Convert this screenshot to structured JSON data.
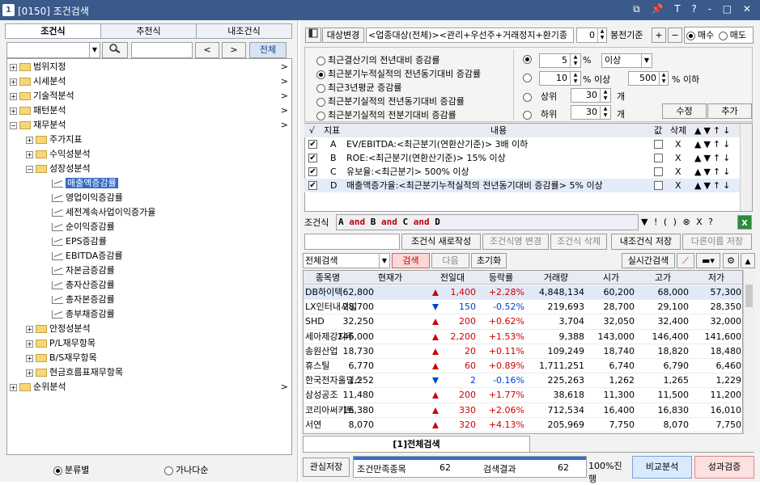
{
  "window": {
    "num": "1",
    "title": "[0150] 조건검색",
    "controls": "⧉ 📌 T ? ‑ □ ✕"
  },
  "left": {
    "tabs": [
      "조건식",
      "추천식",
      "내조건식"
    ],
    "search": {
      "prev": "<",
      "next": ">",
      "all": "전체"
    },
    "tree": [
      {
        "label": "범위지정",
        "level": 0,
        "type": "folder",
        "pm": "+",
        "arrow": ">"
      },
      {
        "label": "시세분석",
        "level": 0,
        "type": "folder",
        "pm": "+",
        "arrow": ">"
      },
      {
        "label": "기술적분석",
        "level": 0,
        "type": "folder",
        "pm": "+",
        "arrow": ">"
      },
      {
        "label": "패턴분석",
        "level": 0,
        "type": "folder",
        "pm": "+",
        "arrow": ">"
      },
      {
        "label": "재무분석",
        "level": 0,
        "type": "folder",
        "pm": "−",
        "arrow": ">"
      },
      {
        "label": "주가지표",
        "level": 1,
        "type": "folder",
        "pm": "+",
        "arrow": ""
      },
      {
        "label": "수익성분석",
        "level": 1,
        "type": "folder",
        "pm": "+",
        "arrow": ""
      },
      {
        "label": "성장성분석",
        "level": 1,
        "type": "folder",
        "pm": "−",
        "arrow": ""
      },
      {
        "label": "매출액증감률",
        "level": 2,
        "type": "chart",
        "pm": "",
        "arrow": "",
        "selected": true
      },
      {
        "label": "영업이익증감률",
        "level": 2,
        "type": "chart",
        "pm": "",
        "arrow": ""
      },
      {
        "label": "세전계속사업이익증가율",
        "level": 2,
        "type": "chart",
        "pm": "",
        "arrow": ""
      },
      {
        "label": "순이익증감률",
        "level": 2,
        "type": "chart",
        "pm": "",
        "arrow": ""
      },
      {
        "label": "EPS증감률",
        "level": 2,
        "type": "chart",
        "pm": "",
        "arrow": ""
      },
      {
        "label": "EBITDA증감률",
        "level": 2,
        "type": "chart",
        "pm": "",
        "arrow": ""
      },
      {
        "label": "자본금증감률",
        "level": 2,
        "type": "chart",
        "pm": "",
        "arrow": ""
      },
      {
        "label": "총자산증감률",
        "level": 2,
        "type": "chart",
        "pm": "",
        "arrow": ""
      },
      {
        "label": "총자본증감률",
        "level": 2,
        "type": "chart",
        "pm": "",
        "arrow": ""
      },
      {
        "label": "총부채증감률",
        "level": 2,
        "type": "chart",
        "pm": "",
        "arrow": ""
      },
      {
        "label": "안정성분석",
        "level": 1,
        "type": "folder",
        "pm": "+",
        "arrow": ""
      },
      {
        "label": "P/L재무항목",
        "level": 1,
        "type": "folder",
        "pm": "+",
        "arrow": ""
      },
      {
        "label": "B/S재무항목",
        "level": 1,
        "type": "folder",
        "pm": "+",
        "arrow": ""
      },
      {
        "label": "현금흐름표재무항목",
        "level": 1,
        "type": "folder",
        "pm": "+",
        "arrow": ""
      },
      {
        "label": "순위분석",
        "level": 0,
        "type": "folder",
        "pm": "+",
        "arrow": ">"
      }
    ],
    "radio1": "분류별",
    "radio2": "가나다순"
  },
  "top": {
    "target_btn": "대상변경",
    "target_text": "<업종대상(전체)><관리+우선주+거래정지+환기종",
    "count": "0",
    "base_btn": "봉전기준",
    "plus": "+",
    "minus": "−",
    "buy": "매수",
    "sell": "매도"
  },
  "options": [
    "최근결산기의 전년대비 증감률",
    "최근분기누적실적의 전년동기대비 증감률",
    "최근3년평균 증감률",
    "최근분기실적의 전년동기대비 증감률",
    "최근분기실적의 전분기대비 증감률"
  ],
  "params": {
    "p1_val": "5",
    "p1_unit": "%",
    "p1_sel": "이상",
    "p2_val": "10",
    "p2_unit": "% 이상",
    "p2_val2": "500",
    "p2_unit2": "% 이하",
    "p3_label": "상위",
    "p3_val": "30",
    "p3_unit": "개",
    "p4_label": "하위",
    "p4_val": "30",
    "p4_unit": "개",
    "modify": "수정",
    "add": "추가"
  },
  "cond_header": {
    "check": "√",
    "idx": "지표",
    "content": "내용",
    "val": "값",
    "del": "삭제"
  },
  "conditions": [
    {
      "id": "A",
      "text": "EV/EBITDA:<최근분기(연환산기준)> 3배 이하"
    },
    {
      "id": "B",
      "text": "ROE:<최근분기(연환산기준)> 15% 이상"
    },
    {
      "id": "C",
      "text": "유보율:<최근분기> 500% 이상"
    },
    {
      "id": "D",
      "text": "매출액증가율:<최근분기누적실적의 전년동기대비 증감률> 5% 이상"
    }
  ],
  "cond_row_ctrls": {
    "del": "X",
    "arrows": "▲▼↑↓"
  },
  "formula": {
    "label": "조건식",
    "A": "A",
    "and1": "and",
    "B": "B",
    "and2": "and",
    "C": "C",
    "and3": "and",
    "D": "D",
    "ops": "▼ ! ( ) ⊗ X ?"
  },
  "actions": {
    "new": "조건식 새로작성",
    "rename": "조건식명 변경",
    "delete": "조건식 삭제",
    "save": "내조건식 저장",
    "saveas": "다른이름 저장"
  },
  "search_bar": {
    "scope": "전체검색",
    "search": "검색",
    "next": "다음",
    "reset": "초기화",
    "realtime": "실시간검색"
  },
  "grid_header": [
    "종목명",
    "현재가",
    "전일대비",
    "등락률",
    "거래량",
    "시가",
    "고가",
    "저가"
  ],
  "grid_rows": [
    {
      "name": "DB하이텍",
      "price": "62,800",
      "dir": "up",
      "chg": "1,400",
      "rate": "+2.28%",
      "vol": "4,848,134",
      "open": "60,200",
      "high": "68,000",
      "low": "57,300"
    },
    {
      "name": "LX인터내셔널",
      "price": "28,700",
      "dir": "dn",
      "chg": "150",
      "rate": "-0.52%",
      "vol": "219,693",
      "open": "28,700",
      "high": "29,100",
      "low": "28,350"
    },
    {
      "name": "SHD",
      "price": "32,250",
      "dir": "up",
      "chg": "200",
      "rate": "+0.62%",
      "vol": "3,704",
      "open": "32,050",
      "high": "32,400",
      "low": "32,000"
    },
    {
      "name": "세아제강지주",
      "price": "146,000",
      "dir": "up",
      "chg": "2,200",
      "rate": "+1.53%",
      "vol": "9,388",
      "open": "143,000",
      "high": "146,400",
      "low": "141,600"
    },
    {
      "name": "송원산업",
      "price": "18,730",
      "dir": "up",
      "chg": "20",
      "rate": "+0.11%",
      "vol": "109,249",
      "open": "18,740",
      "high": "18,820",
      "low": "18,480"
    },
    {
      "name": "휴스틸",
      "price": "6,770",
      "dir": "up",
      "chg": "60",
      "rate": "+0.89%",
      "vol": "1,711,251",
      "open": "6,740",
      "high": "6,790",
      "low": "6,460"
    },
    {
      "name": "한국전자홀딩스",
      "price": "1,252",
      "dir": "dn",
      "chg": "2",
      "rate": "-0.16%",
      "vol": "225,263",
      "open": "1,262",
      "high": "1,265",
      "low": "1,229"
    },
    {
      "name": "삼성공조",
      "price": "11,480",
      "dir": "up",
      "chg": "200",
      "rate": "+1.77%",
      "vol": "38,618",
      "open": "11,300",
      "high": "11,500",
      "low": "11,200"
    },
    {
      "name": "코리아써키트",
      "price": "16,380",
      "dir": "up",
      "chg": "330",
      "rate": "+2.06%",
      "vol": "712,534",
      "open": "16,400",
      "high": "16,830",
      "low": "16,010"
    },
    {
      "name": "서연",
      "price": "8,070",
      "dir": "up",
      "chg": "320",
      "rate": "+4.13%",
      "vol": "205,969",
      "open": "7,750",
      "high": "8,070",
      "low": "7,750"
    }
  ],
  "bottom_tab": "[1]전체검색",
  "footer": {
    "watch": "관심저장",
    "cond_label": "조건만족종목",
    "cond_val": "62",
    "result_label": "검색결과",
    "result_val": "62",
    "progress": "100%진행",
    "progress_pct": 100,
    "compare": "비교분석",
    "verify": "성과검증"
  }
}
